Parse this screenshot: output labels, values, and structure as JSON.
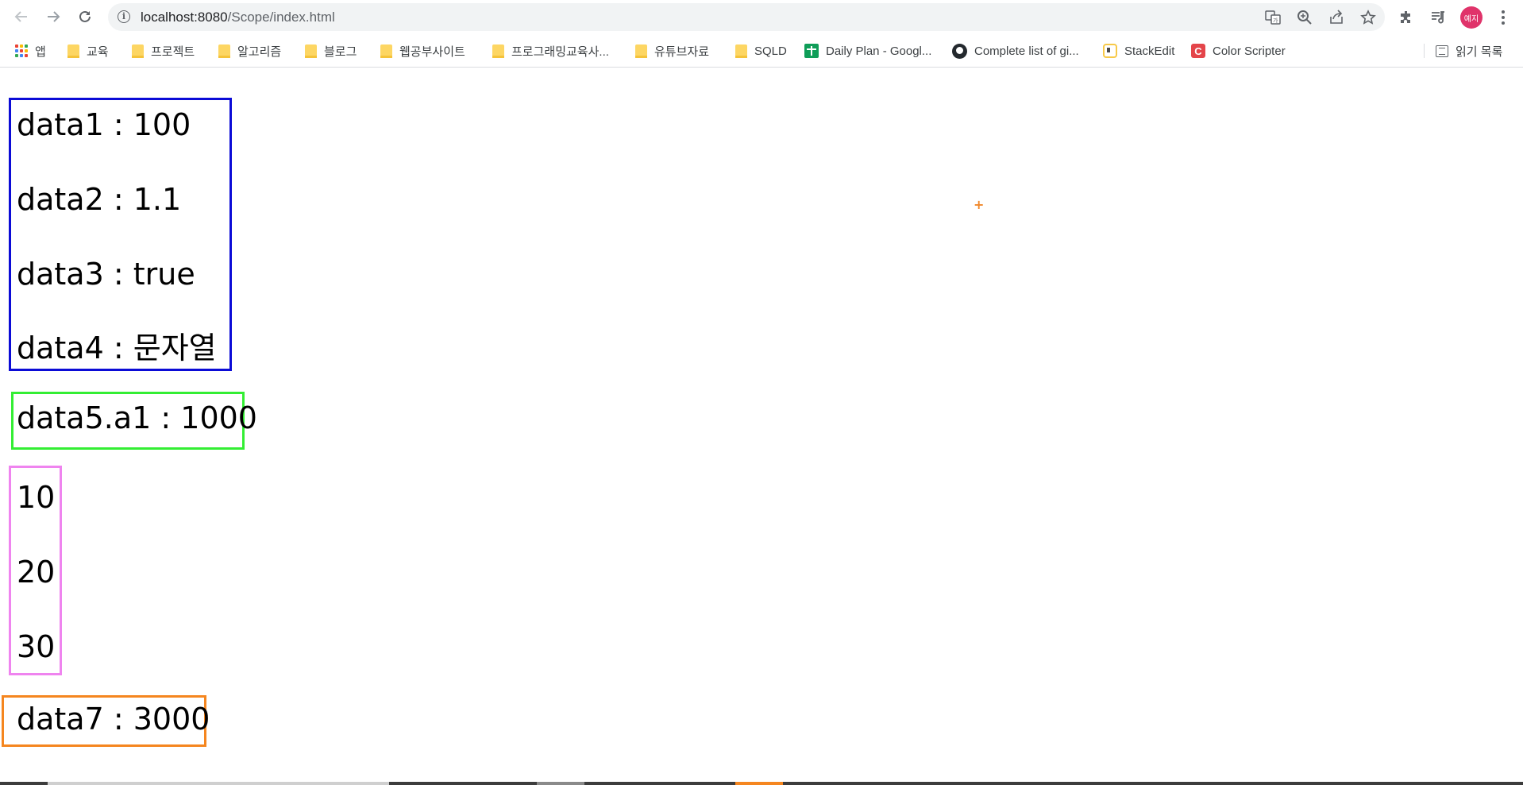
{
  "browser": {
    "url_host": "localhost:8080",
    "url_path": "/Scope/index.html",
    "avatar_text": "예지"
  },
  "bookmarks": {
    "apps_label": "앱",
    "items": [
      {
        "label": "교육",
        "icon": "folder-icon"
      },
      {
        "label": "프로젝트",
        "icon": "folder-icon"
      },
      {
        "label": "알고리즘",
        "icon": "folder-icon"
      },
      {
        "label": "블로그",
        "icon": "folder-icon"
      },
      {
        "label": "웹공부사이트",
        "icon": "folder-icon"
      },
      {
        "label": "프로그래밍교육사...",
        "icon": "folder-icon"
      },
      {
        "label": "유튜브자료",
        "icon": "folder-icon"
      },
      {
        "label": "SQLD",
        "icon": "folder-icon"
      },
      {
        "label": "Daily Plan - Googl...",
        "icon": "google-sheets-icon"
      },
      {
        "label": "Complete list of gi...",
        "icon": "github-icon"
      },
      {
        "label": "StackEdit",
        "icon": "stackedit-icon"
      },
      {
        "label": "Color Scripter",
        "icon": "color-scripter-icon"
      }
    ],
    "reading_list_label": "읽기 목록"
  },
  "content": {
    "blue_box": {
      "line1": "data1 : 100",
      "line2": "data2 : 1.1",
      "line3": "data3 : true",
      "line4": "data4 : 문자열"
    },
    "green_box": {
      "line1": "data5.a1 : 1000"
    },
    "pink_box": {
      "line1": "10",
      "line2": "20",
      "line3": "30"
    },
    "orange_box": {
      "line1": "data7 : 3000"
    }
  },
  "colors": {
    "blue_border": "#0b0bd6",
    "green_border": "#33ee33",
    "pink_border": "#ef84ef",
    "orange_border": "#f5861f"
  }
}
